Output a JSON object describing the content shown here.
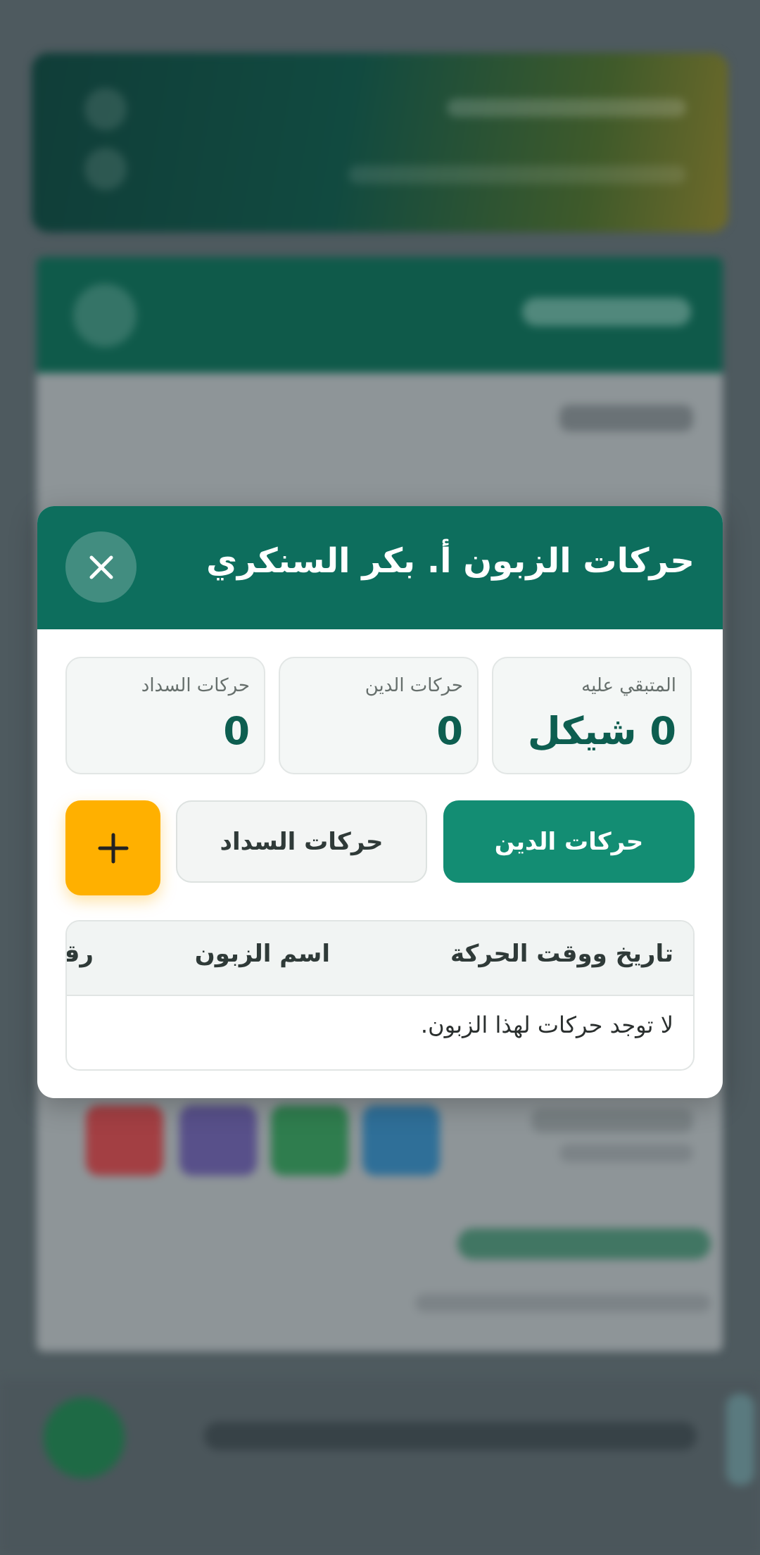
{
  "modal": {
    "title": "حركات الزبون أ. بكر السنكري",
    "stats": [
      {
        "label": "المتبقي عليه",
        "value": "0 شيكل"
      },
      {
        "label": "حركات الدين",
        "value": "0"
      },
      {
        "label": "حركات السداد",
        "value": "0"
      }
    ],
    "tabs": {
      "debt": "حركات الدين",
      "payment": "حركات السداد"
    },
    "table": {
      "headers": [
        "تاريخ ووقت الحركة",
        "اسم الزبون",
        "رقم"
      ],
      "empty_message": "لا توجد حركات لهذا الزبون."
    }
  },
  "colors": {
    "header": "#0d6e5d",
    "active_tab": "#138d73",
    "add_button": "#ffb000",
    "stat_value": "#0d5e50"
  },
  "icons": {
    "close": "close-icon",
    "add": "plus-icon"
  }
}
